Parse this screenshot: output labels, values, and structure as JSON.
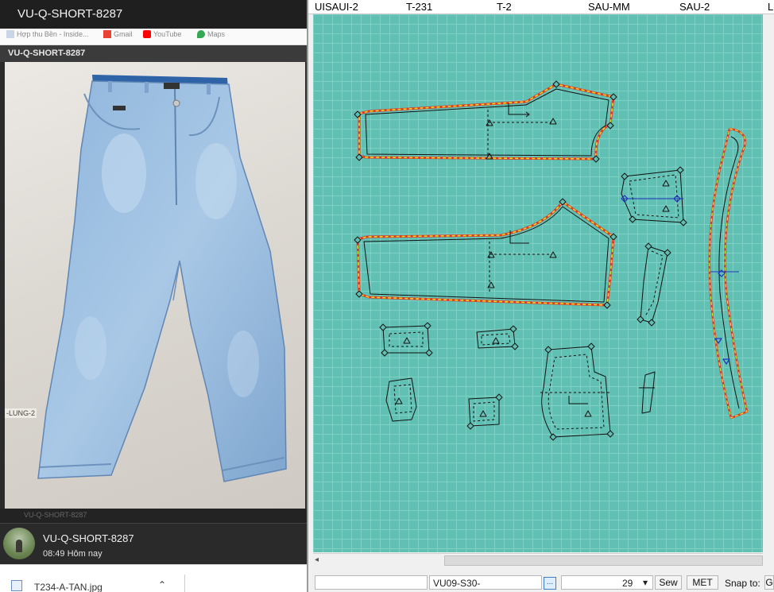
{
  "left_window": {
    "title": "VU-Q-SHORT-8287",
    "bookmarks": [
      "Hợp thu Bền - Inside...",
      "Gmail",
      "YouTube",
      "Maps"
    ],
    "image_header": "VU-Q-SHORT-8287",
    "photo_side_label": "-LUNG-2",
    "ghost_text": "VU-Q-SHORT-8287",
    "message": {
      "sender": "VU-Q-SHORT-8287",
      "time": "08:49 Hôm nay"
    },
    "download": {
      "filename": "T234-A-TAN.jpg",
      "chevron": "⌃"
    }
  },
  "cad": {
    "piece_titles": [
      "UISAUI-2",
      "T-231",
      "T-2",
      "SAU-MM",
      "SAU-2",
      "L"
    ],
    "grid_color": "#5fc0b3",
    "status_bar": {
      "field_left": "",
      "style_code": "VU09-S30-",
      "browse_button": "...",
      "size_value": "29",
      "size_dropdown": "▾",
      "sew_button": "Sew",
      "unit_button": "MET",
      "snap_label": "Snap to:",
      "snap_value": "G"
    },
    "scroll_left_arrow": "◂"
  }
}
